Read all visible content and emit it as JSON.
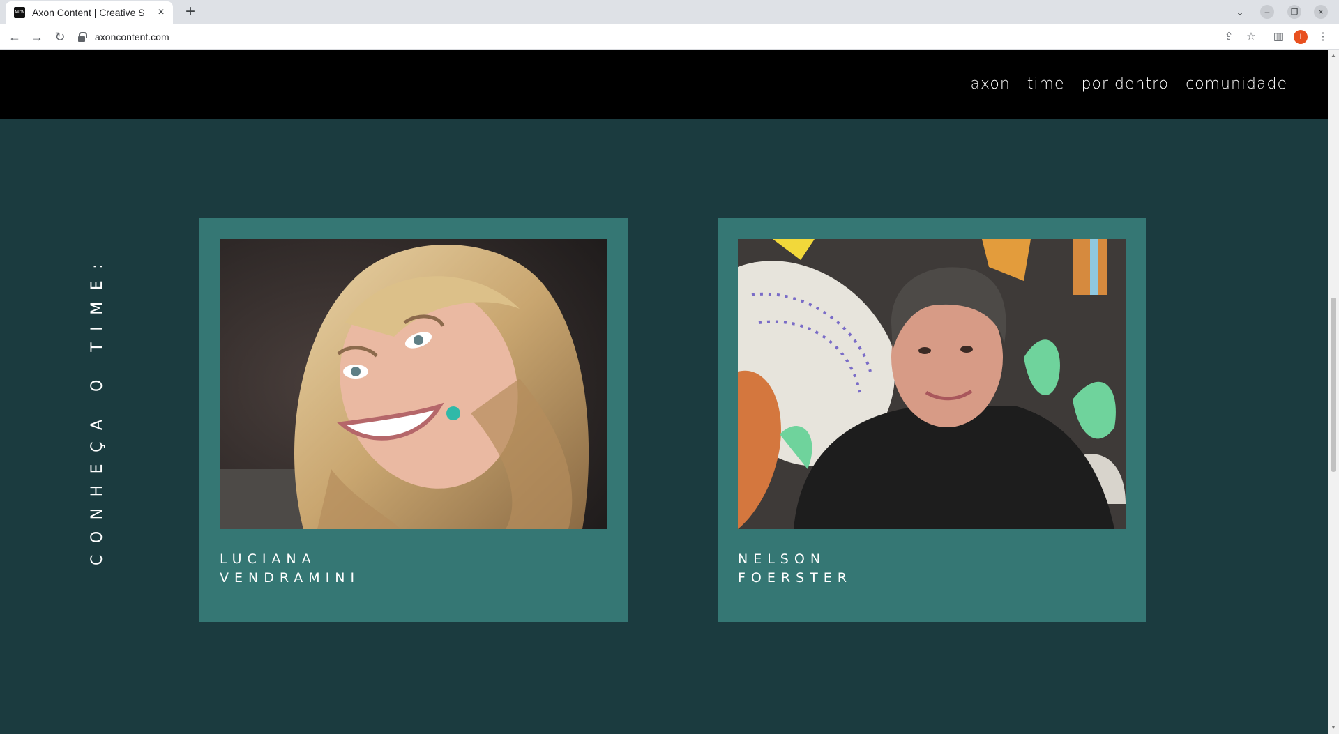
{
  "browser": {
    "tab_title": "Axon Content | Creative S",
    "favicon_text": "AXON",
    "new_tab": "+",
    "url": "axoncontent.com",
    "profile_initial": "I"
  },
  "nav": {
    "items": [
      "axon",
      "time",
      "por dentro",
      "comunidade"
    ]
  },
  "section": {
    "heading": "CONHEÇA O TIME:"
  },
  "team": [
    {
      "first": "LUCIANA",
      "last": "VENDRAMINI",
      "photo": "portrait of smiling blonde woman"
    },
    {
      "first": "NELSON",
      "last": "FOERSTER",
      "photo": "portrait of man in black t-shirt in front of colorful mural"
    }
  ],
  "colors": {
    "page_bg": "#1b3b3f",
    "card_bg": "#357774",
    "header_bg": "#000000"
  }
}
